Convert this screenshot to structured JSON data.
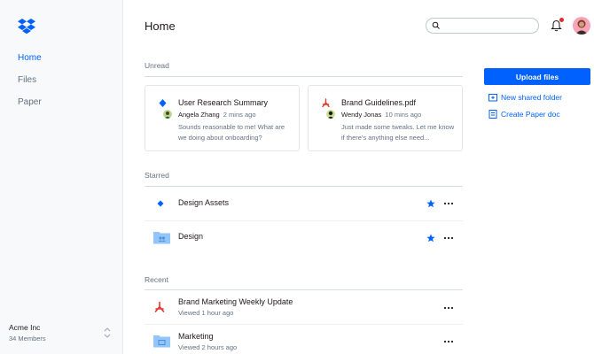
{
  "sidebar": {
    "logo": "dropbox-logo",
    "nav": [
      {
        "label": "Home",
        "active": true
      },
      {
        "label": "Files",
        "active": false
      },
      {
        "label": "Paper",
        "active": false
      }
    ],
    "team": {
      "name": "Acme Inc",
      "members": "34 Members"
    }
  },
  "header": {
    "title": "Home",
    "search_placeholder": "",
    "notification_badge": true
  },
  "unread": {
    "title": "Unread",
    "cards": [
      {
        "icon": "paper-doc-icon",
        "title": "User Research Summary",
        "author": "Angela Zhang",
        "time": "2 mins ago",
        "body": "Sounds reasonable to me! What are we doing about onboarding?"
      },
      {
        "icon": "pdf-icon",
        "title": "Brand Guidelines.pdf",
        "author": "Wendy Jonas",
        "time": "10 mins ago",
        "body": "Just made some tweaks. Let me know if there's anything else need..."
      }
    ]
  },
  "starred": {
    "title": "Starred",
    "items": [
      {
        "icon": "paper-doc-icon",
        "name": "Design Assets"
      },
      {
        "icon": "shared-folder-icon",
        "name": "Design"
      }
    ]
  },
  "recent": {
    "title": "Recent",
    "items": [
      {
        "icon": "pdf-icon",
        "name": "Brand Marketing Weekly Update",
        "sub": "Viewed 1 hour ago"
      },
      {
        "icon": "folder-icon",
        "name": "Marketing",
        "sub": "Viewed 2 hours ago"
      }
    ]
  },
  "actions": {
    "upload": "Upload files",
    "new_shared_folder": "New shared folder",
    "create_paper_doc": "Create Paper doc"
  },
  "colors": {
    "accent": "#0061fe",
    "pdf": "#e2382d",
    "folder": "#92c5f9",
    "sidebar_bg": "#f7f9fa"
  }
}
